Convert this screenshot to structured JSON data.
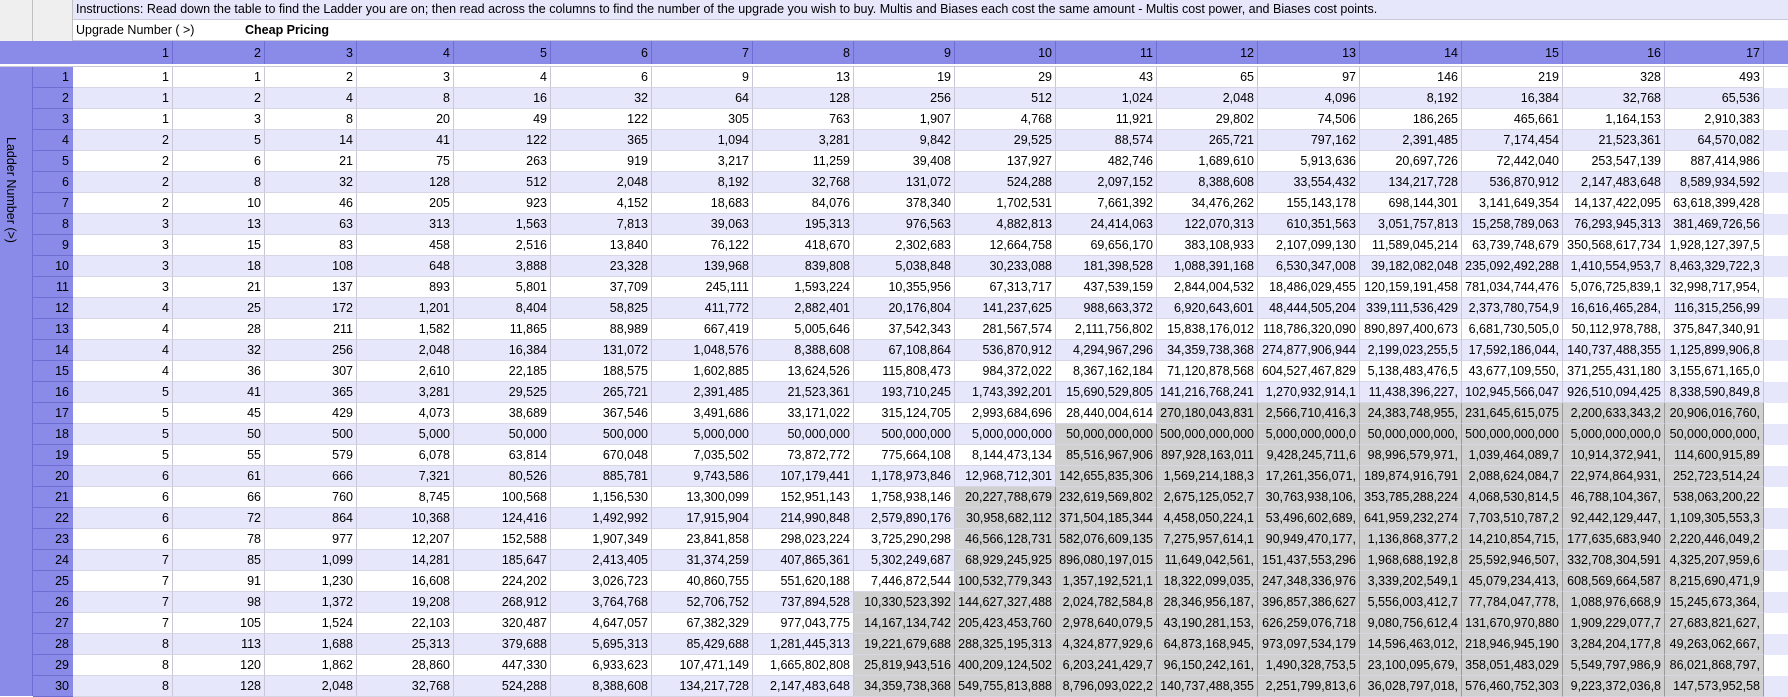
{
  "instructions": "Instructions: Read down the table to find the Ladder you are on; then read across the columns to find the number of the upgrade you wish to buy. Multis and Biases each cost the same amount - Multis cost power, and Biases cost points.",
  "upgrade_label": "Upgrade Number ( >)",
  "pricing_label": "Cheap Pricing",
  "ladder_label": "Ladder Number (>)",
  "colors": {
    "header_blue": "#8a8ae8",
    "band_lavender": "#e7e7fb",
    "gray_cell": "#d0d0d0"
  },
  "column_headers": [
    "1",
    "2",
    "3",
    "4",
    "5",
    "6",
    "7",
    "8",
    "9",
    "10",
    "11",
    "12",
    "13",
    "14",
    "15",
    "16",
    "17"
  ],
  "rows": [
    {
      "n": "1",
      "cells": [
        "1",
        "1",
        "2",
        "3",
        "4",
        "6",
        "9",
        "13",
        "19",
        "29",
        "43",
        "65",
        "97",
        "146",
        "219",
        "328",
        "493"
      ]
    },
    {
      "n": "2",
      "cells": [
        "1",
        "2",
        "4",
        "8",
        "16",
        "32",
        "64",
        "128",
        "256",
        "512",
        "1,024",
        "2,048",
        "4,096",
        "8,192",
        "16,384",
        "32,768",
        "65,536"
      ]
    },
    {
      "n": "3",
      "cells": [
        "1",
        "3",
        "8",
        "20",
        "49",
        "122",
        "305",
        "763",
        "1,907",
        "4,768",
        "11,921",
        "29,802",
        "74,506",
        "186,265",
        "465,661",
        "1,164,153",
        "2,910,383"
      ]
    },
    {
      "n": "4",
      "cells": [
        "2",
        "5",
        "14",
        "41",
        "122",
        "365",
        "1,094",
        "3,281",
        "9,842",
        "29,525",
        "88,574",
        "265,721",
        "797,162",
        "2,391,485",
        "7,174,454",
        "21,523,361",
        "64,570,082"
      ]
    },
    {
      "n": "5",
      "cells": [
        "2",
        "6",
        "21",
        "75",
        "263",
        "919",
        "3,217",
        "11,259",
        "39,408",
        "137,927",
        "482,746",
        "1,689,610",
        "5,913,636",
        "20,697,726",
        "72,442,040",
        "253,547,139",
        "887,414,986"
      ]
    },
    {
      "n": "6",
      "cells": [
        "2",
        "8",
        "32",
        "128",
        "512",
        "2,048",
        "8,192",
        "32,768",
        "131,072",
        "524,288",
        "2,097,152",
        "8,388,608",
        "33,554,432",
        "134,217,728",
        "536,870,912",
        "2,147,483,648",
        "8,589,934,592"
      ]
    },
    {
      "n": "7",
      "cells": [
        "2",
        "10",
        "46",
        "205",
        "923",
        "4,152",
        "18,683",
        "84,076",
        "378,340",
        "1,702,531",
        "7,661,392",
        "34,476,262",
        "155,143,178",
        "698,144,301",
        "3,141,649,354",
        "14,137,422,095",
        "63,618,399,428"
      ]
    },
    {
      "n": "8",
      "cells": [
        "3",
        "13",
        "63",
        "313",
        "1,563",
        "7,813",
        "39,063",
        "195,313",
        "976,563",
        "4,882,813",
        "24,414,063",
        "122,070,313",
        "610,351,563",
        "3,051,757,813",
        "15,258,789,063",
        "76,293,945,313",
        "381,469,726,56"
      ]
    },
    {
      "n": "9",
      "cells": [
        "3",
        "15",
        "83",
        "458",
        "2,516",
        "13,840",
        "76,122",
        "418,670",
        "2,302,683",
        "12,664,758",
        "69,656,170",
        "383,108,933",
        "2,107,099,130",
        "11,589,045,214",
        "63,739,748,679",
        "350,568,617,734",
        "1,928,127,397,5"
      ]
    },
    {
      "n": "10",
      "cells": [
        "3",
        "18",
        "108",
        "648",
        "3,888",
        "23,328",
        "139,968",
        "839,808",
        "5,038,848",
        "30,233,088",
        "181,398,528",
        "1,088,391,168",
        "6,530,347,008",
        "39,182,082,048",
        "235,092,492,288",
        "1,410,554,953,7",
        "8,463,329,722,3"
      ]
    },
    {
      "n": "11",
      "cells": [
        "3",
        "21",
        "137",
        "893",
        "5,801",
        "37,709",
        "245,111",
        "1,593,224",
        "10,355,956",
        "67,313,717",
        "437,539,159",
        "2,844,004,532",
        "18,486,029,455",
        "120,159,191,458",
        "781,034,744,476",
        "5,076,725,839,1",
        "32,998,717,954,"
      ]
    },
    {
      "n": "12",
      "cells": [
        "4",
        "25",
        "172",
        "1,201",
        "8,404",
        "58,825",
        "411,772",
        "2,882,401",
        "20,176,804",
        "141,237,625",
        "988,663,372",
        "6,920,643,601",
        "48,444,505,204",
        "339,111,536,429",
        "2,373,780,754,9",
        "16,616,465,284,",
        "116,315,256,99"
      ]
    },
    {
      "n": "13",
      "cells": [
        "4",
        "28",
        "211",
        "1,582",
        "11,865",
        "88,989",
        "667,419",
        "5,005,646",
        "37,542,343",
        "281,567,574",
        "2,111,756,802",
        "15,838,176,012",
        "118,786,320,090",
        "890,897,400,673",
        "6,681,730,505,0",
        "50,112,978,788,",
        "375,847,340,91"
      ]
    },
    {
      "n": "14",
      "cells": [
        "4",
        "32",
        "256",
        "2,048",
        "16,384",
        "131,072",
        "1,048,576",
        "8,388,608",
        "67,108,864",
        "536,870,912",
        "4,294,967,296",
        "34,359,738,368",
        "274,877,906,944",
        "2,199,023,255,5",
        "17,592,186,044,",
        "140,737,488,355",
        "1,125,899,906,8"
      ]
    },
    {
      "n": "15",
      "cells": [
        "4",
        "36",
        "307",
        "2,610",
        "22,185",
        "188,575",
        "1,602,885",
        "13,624,526",
        "115,808,473",
        "984,372,022",
        "8,367,162,184",
        "71,120,878,568",
        "604,527,467,829",
        "5,138,483,476,5",
        "43,677,109,550,",
        "371,255,431,180",
        "3,155,671,165,0"
      ]
    },
    {
      "n": "16",
      "cells": [
        "5",
        "41",
        "365",
        "3,281",
        "29,525",
        "265,721",
        "2,391,485",
        "21,523,361",
        "193,710,245",
        "1,743,392,201",
        "15,690,529,805",
        "141,216,768,241",
        "1,270,932,914,1",
        "11,438,396,227,",
        "102,945,566,047",
        "926,510,094,425",
        "8,338,590,849,8"
      ]
    },
    {
      "n": "17",
      "cells": [
        "5",
        "45",
        "429",
        "4,073",
        "38,689",
        "367,546",
        "3,491,686",
        "33,171,022",
        "315,124,705",
        "2,993,684,696",
        "28,440,004,614",
        "270,180,043,831",
        "2,566,710,416,3",
        "24,383,748,955,",
        "231,645,615,075",
        "2,200,633,343,2",
        "20,906,016,760,"
      ]
    },
    {
      "n": "18",
      "cells": [
        "5",
        "50",
        "500",
        "5,000",
        "50,000",
        "500,000",
        "5,000,000",
        "50,000,000",
        "500,000,000",
        "5,000,000,000",
        "50,000,000,000",
        "500,000,000,000",
        "5,000,000,000,0",
        "50,000,000,000,",
        "500,000,000,000",
        "5,000,000,000,0",
        "50,000,000,000,"
      ]
    },
    {
      "n": "19",
      "cells": [
        "5",
        "55",
        "579",
        "6,078",
        "63,814",
        "670,048",
        "7,035,502",
        "73,872,772",
        "775,664,108",
        "8,144,473,134",
        "85,516,967,906",
        "897,928,163,011",
        "9,428,245,711,6",
        "98,996,579,971,",
        "1,039,464,089,7",
        "10,914,372,941,",
        "114,600,915,89"
      ]
    },
    {
      "n": "20",
      "cells": [
        "6",
        "61",
        "666",
        "7,321",
        "80,526",
        "885,781",
        "9,743,586",
        "107,179,441",
        "1,178,973,846",
        "12,968,712,301",
        "142,655,835,306",
        "1,569,214,188,3",
        "17,261,356,071,",
        "189,874,916,791",
        "2,088,624,084,7",
        "22,974,864,931,",
        "252,723,514,24"
      ]
    },
    {
      "n": "21",
      "cells": [
        "6",
        "66",
        "760",
        "8,745",
        "100,568",
        "1,156,530",
        "13,300,099",
        "152,951,143",
        "1,758,938,146",
        "20,227,788,679",
        "232,619,569,802",
        "2,675,125,052,7",
        "30,763,938,106,",
        "353,785,288,224",
        "4,068,530,814,5",
        "46,788,104,367,",
        "538,063,200,22"
      ]
    },
    {
      "n": "22",
      "cells": [
        "6",
        "72",
        "864",
        "10,368",
        "124,416",
        "1,492,992",
        "17,915,904",
        "214,990,848",
        "2,579,890,176",
        "30,958,682,112",
        "371,504,185,344",
        "4,458,050,224,1",
        "53,496,602,689,",
        "641,959,232,274",
        "7,703,510,787,2",
        "92,442,129,447,",
        "1,109,305,553,3"
      ]
    },
    {
      "n": "23",
      "cells": [
        "6",
        "78",
        "977",
        "12,207",
        "152,588",
        "1,907,349",
        "23,841,858",
        "298,023,224",
        "3,725,290,298",
        "46,566,128,731",
        "582,076,609,135",
        "7,275,957,614,1",
        "90,949,470,177,",
        "1,136,868,377,2",
        "14,210,854,715,",
        "177,635,683,940",
        "2,220,446,049,2"
      ]
    },
    {
      "n": "24",
      "cells": [
        "7",
        "85",
        "1,099",
        "14,281",
        "185,647",
        "2,413,405",
        "31,374,259",
        "407,865,361",
        "5,302,249,687",
        "68,929,245,925",
        "896,080,197,015",
        "11,649,042,561,",
        "151,437,553,296",
        "1,968,688,192,8",
        "25,592,946,507,",
        "332,708,304,591",
        "4,325,207,959,6"
      ]
    },
    {
      "n": "25",
      "cells": [
        "7",
        "91",
        "1,230",
        "16,608",
        "224,202",
        "3,026,723",
        "40,860,755",
        "551,620,188",
        "7,446,872,544",
        "100,532,779,343",
        "1,357,192,521,1",
        "18,322,099,035,",
        "247,348,336,976",
        "3,339,202,549,1",
        "45,079,234,413,",
        "608,569,664,587",
        "8,215,690,471,9"
      ]
    },
    {
      "n": "26",
      "cells": [
        "7",
        "98",
        "1,372",
        "19,208",
        "268,912",
        "3,764,768",
        "52,706,752",
        "737,894,528",
        "10,330,523,392",
        "144,627,327,488",
        "2,024,782,584,8",
        "28,346,956,187,",
        "396,857,386,627",
        "5,556,003,412,7",
        "77,784,047,778,",
        "1,088,976,668,9",
        "15,245,673,364,"
      ]
    },
    {
      "n": "27",
      "cells": [
        "7",
        "105",
        "1,524",
        "22,103",
        "320,487",
        "4,647,057",
        "67,382,329",
        "977,043,775",
        "14,167,134,742",
        "205,423,453,760",
        "2,978,640,079,5",
        "43,190,281,153,",
        "626,259,076,718",
        "9,080,756,612,4",
        "131,670,970,880",
        "1,909,229,077,7",
        "27,683,821,627,"
      ]
    },
    {
      "n": "28",
      "cells": [
        "8",
        "113",
        "1,688",
        "25,313",
        "379,688",
        "5,695,313",
        "85,429,688",
        "1,281,445,313",
        "19,221,679,688",
        "288,325,195,313",
        "4,324,877,929,6",
        "64,873,168,945,",
        "973,097,534,179",
        "14,596,463,012,",
        "218,946,945,190",
        "3,284,204,177,8",
        "49,263,062,667,"
      ]
    },
    {
      "n": "29",
      "cells": [
        "8",
        "120",
        "1,862",
        "28,860",
        "447,330",
        "6,933,623",
        "107,471,149",
        "1,665,802,808",
        "25,819,943,516",
        "400,209,124,502",
        "6,203,241,429,7",
        "96,150,242,161,",
        "1,490,328,753,5",
        "23,100,095,679,",
        "358,051,483,029",
        "5,549,797,986,9",
        "86,021,868,797,"
      ]
    },
    {
      "n": "30",
      "cells": [
        "8",
        "128",
        "2,048",
        "32,768",
        "524,288",
        "8,388,608",
        "134,217,728",
        "2,147,483,648",
        "34,359,738,368",
        "549,755,813,888",
        "8,796,093,022,2",
        "140,737,488,355",
        "2,251,799,813,6",
        "36,028,797,018,",
        "576,460,752,303",
        "9,223,372,036,8",
        "147,573,952,58"
      ]
    }
  ]
}
